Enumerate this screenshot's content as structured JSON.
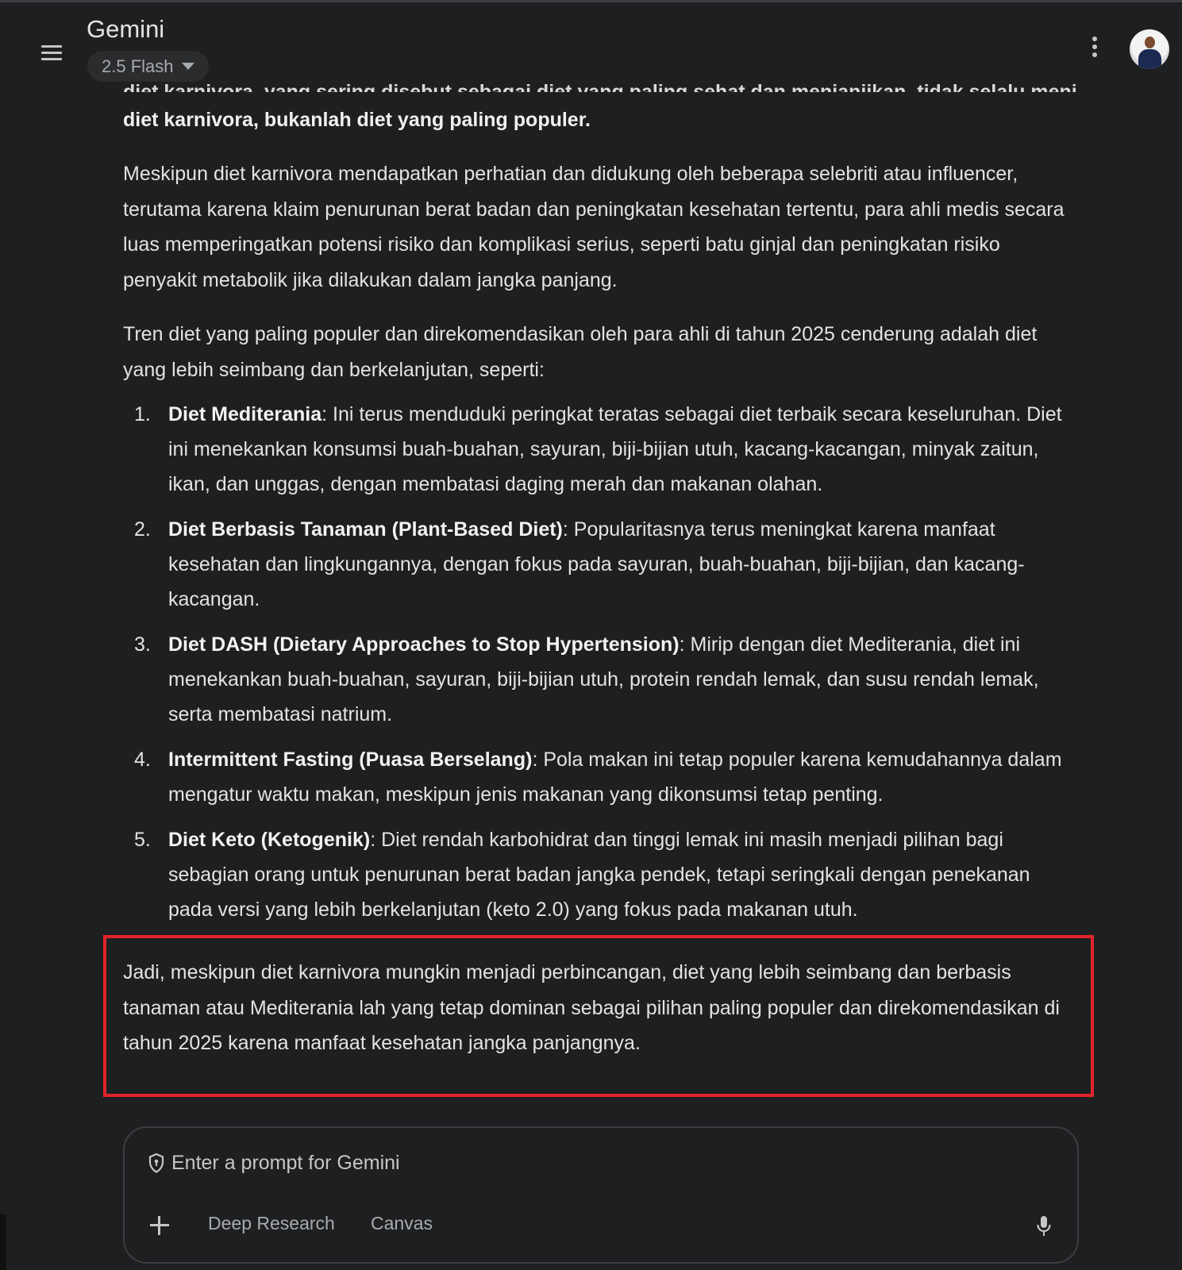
{
  "header": {
    "title": "Gemini",
    "model": "2.5 Flash"
  },
  "response": {
    "cut_line": "diet karnivora, yang sering disebut sebagai diet yang paling sehat dan menjanjikan, tidak selalu menjadi",
    "bold_line": "diet karnivora, bukanlah diet yang paling populer.",
    "para1": "Meskipun diet karnivora mendapatkan perhatian dan didukung oleh beberapa selebriti atau influencer, terutama karena klaim penurunan berat badan dan peningkatan kesehatan tertentu, para ahli medis secara luas memperingatkan potensi risiko dan komplikasi serius, seperti batu ginjal dan peningkatan risiko penyakit metabolik jika dilakukan dalam jangka panjang.",
    "para2": "Tren diet yang paling populer dan direkomendasikan oleh para ahli di tahun 2025 cenderung adalah diet yang lebih seimbang dan berkelanjutan, seperti:",
    "list": [
      {
        "num": "1.",
        "title": "Diet Mediterania",
        "text": ": Ini terus menduduki peringkat teratas sebagai diet terbaik secara keseluruhan. Diet ini menekankan konsumsi buah-buahan, sayuran, biji-bijian utuh, kacang-kacangan, minyak zaitun, ikan, dan unggas, dengan membatasi daging merah dan makanan olahan."
      },
      {
        "num": "2.",
        "title": "Diet Berbasis Tanaman (Plant-Based Diet)",
        "text": ": Popularitasnya terus meningkat karena manfaat kesehatan dan lingkungannya, dengan fokus pada sayuran, buah-buahan, biji-bijian, dan kacang-kacangan."
      },
      {
        "num": "3.",
        "title": "Diet DASH (Dietary Approaches to Stop Hypertension)",
        "text": ": Mirip dengan diet Mediterania, diet ini menekankan buah-buahan, sayuran, biji-bijian utuh, protein rendah lemak, dan susu rendah lemak, serta membatasi natrium."
      },
      {
        "num": "4.",
        "title": "Intermittent Fasting (Puasa Berselang)",
        "text": ": Pola makan ini tetap populer karena kemudahannya dalam mengatur waktu makan, meskipun jenis makanan yang dikonsumsi tetap penting."
      },
      {
        "num": "5.",
        "title": "Diet Keto (Ketogenik)",
        "text": ": Diet rendah karbohidrat dan tinggi lemak ini masih menjadi pilihan bagi sebagian orang untuk penurunan berat badan jangka pendek, tetapi seringkali dengan penekanan pada versi yang lebih berkelanjutan (keto 2.0) yang fokus pada makanan utuh."
      }
    ],
    "summary": "Jadi, meskipun diet karnivora mungkin menjadi perbincangan, diet yang lebih seimbang dan berbasis tanaman atau Mediterania lah yang tetap dominan sebagai pilihan paling populer dan direkomendasikan di tahun 2025 karena manfaat kesehatan jangka panjangnya."
  },
  "prompt": {
    "placeholder": "Enter a prompt for Gemini",
    "tools": [
      "Deep Research",
      "Canvas"
    ]
  },
  "colors": {
    "background": "#1e1f20",
    "highlight_border": "#e1252b",
    "text": "#e3e3e3"
  },
  "icons": [
    "menu-icon",
    "caret-down-icon",
    "more-vert-icon",
    "avatar",
    "shield-icon",
    "plus-icon",
    "mic-icon"
  ]
}
